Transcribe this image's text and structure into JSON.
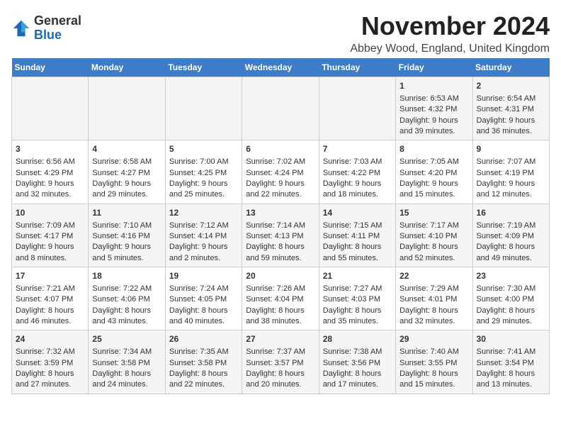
{
  "logo": {
    "general": "General",
    "blue": "Blue"
  },
  "title": "November 2024",
  "location": "Abbey Wood, England, United Kingdom",
  "days_header": [
    "Sunday",
    "Monday",
    "Tuesday",
    "Wednesday",
    "Thursday",
    "Friday",
    "Saturday"
  ],
  "weeks": [
    [
      {
        "day": "",
        "content": ""
      },
      {
        "day": "",
        "content": ""
      },
      {
        "day": "",
        "content": ""
      },
      {
        "day": "",
        "content": ""
      },
      {
        "day": "",
        "content": ""
      },
      {
        "day": "1",
        "content": "Sunrise: 6:53 AM\nSunset: 4:32 PM\nDaylight: 9 hours and 39 minutes."
      },
      {
        "day": "2",
        "content": "Sunrise: 6:54 AM\nSunset: 4:31 PM\nDaylight: 9 hours and 36 minutes."
      }
    ],
    [
      {
        "day": "3",
        "content": "Sunrise: 6:56 AM\nSunset: 4:29 PM\nDaylight: 9 hours and 32 minutes."
      },
      {
        "day": "4",
        "content": "Sunrise: 6:58 AM\nSunset: 4:27 PM\nDaylight: 9 hours and 29 minutes."
      },
      {
        "day": "5",
        "content": "Sunrise: 7:00 AM\nSunset: 4:25 PM\nDaylight: 9 hours and 25 minutes."
      },
      {
        "day": "6",
        "content": "Sunrise: 7:02 AM\nSunset: 4:24 PM\nDaylight: 9 hours and 22 minutes."
      },
      {
        "day": "7",
        "content": "Sunrise: 7:03 AM\nSunset: 4:22 PM\nDaylight: 9 hours and 18 minutes."
      },
      {
        "day": "8",
        "content": "Sunrise: 7:05 AM\nSunset: 4:20 PM\nDaylight: 9 hours and 15 minutes."
      },
      {
        "day": "9",
        "content": "Sunrise: 7:07 AM\nSunset: 4:19 PM\nDaylight: 9 hours and 12 minutes."
      }
    ],
    [
      {
        "day": "10",
        "content": "Sunrise: 7:09 AM\nSunset: 4:17 PM\nDaylight: 9 hours and 8 minutes."
      },
      {
        "day": "11",
        "content": "Sunrise: 7:10 AM\nSunset: 4:16 PM\nDaylight: 9 hours and 5 minutes."
      },
      {
        "day": "12",
        "content": "Sunrise: 7:12 AM\nSunset: 4:14 PM\nDaylight: 9 hours and 2 minutes."
      },
      {
        "day": "13",
        "content": "Sunrise: 7:14 AM\nSunset: 4:13 PM\nDaylight: 8 hours and 59 minutes."
      },
      {
        "day": "14",
        "content": "Sunrise: 7:15 AM\nSunset: 4:11 PM\nDaylight: 8 hours and 55 minutes."
      },
      {
        "day": "15",
        "content": "Sunrise: 7:17 AM\nSunset: 4:10 PM\nDaylight: 8 hours and 52 minutes."
      },
      {
        "day": "16",
        "content": "Sunrise: 7:19 AM\nSunset: 4:09 PM\nDaylight: 8 hours and 49 minutes."
      }
    ],
    [
      {
        "day": "17",
        "content": "Sunrise: 7:21 AM\nSunset: 4:07 PM\nDaylight: 8 hours and 46 minutes."
      },
      {
        "day": "18",
        "content": "Sunrise: 7:22 AM\nSunset: 4:06 PM\nDaylight: 8 hours and 43 minutes."
      },
      {
        "day": "19",
        "content": "Sunrise: 7:24 AM\nSunset: 4:05 PM\nDaylight: 8 hours and 40 minutes."
      },
      {
        "day": "20",
        "content": "Sunrise: 7:26 AM\nSunset: 4:04 PM\nDaylight: 8 hours and 38 minutes."
      },
      {
        "day": "21",
        "content": "Sunrise: 7:27 AM\nSunset: 4:03 PM\nDaylight: 8 hours and 35 minutes."
      },
      {
        "day": "22",
        "content": "Sunrise: 7:29 AM\nSunset: 4:01 PM\nDaylight: 8 hours and 32 minutes."
      },
      {
        "day": "23",
        "content": "Sunrise: 7:30 AM\nSunset: 4:00 PM\nDaylight: 8 hours and 29 minutes."
      }
    ],
    [
      {
        "day": "24",
        "content": "Sunrise: 7:32 AM\nSunset: 3:59 PM\nDaylight: 8 hours and 27 minutes."
      },
      {
        "day": "25",
        "content": "Sunrise: 7:34 AM\nSunset: 3:58 PM\nDaylight: 8 hours and 24 minutes."
      },
      {
        "day": "26",
        "content": "Sunrise: 7:35 AM\nSunset: 3:58 PM\nDaylight: 8 hours and 22 minutes."
      },
      {
        "day": "27",
        "content": "Sunrise: 7:37 AM\nSunset: 3:57 PM\nDaylight: 8 hours and 20 minutes."
      },
      {
        "day": "28",
        "content": "Sunrise: 7:38 AM\nSunset: 3:56 PM\nDaylight: 8 hours and 17 minutes."
      },
      {
        "day": "29",
        "content": "Sunrise: 7:40 AM\nSunset: 3:55 PM\nDaylight: 8 hours and 15 minutes."
      },
      {
        "day": "30",
        "content": "Sunrise: 7:41 AM\nSunset: 3:54 PM\nDaylight: 8 hours and 13 minutes."
      }
    ]
  ]
}
